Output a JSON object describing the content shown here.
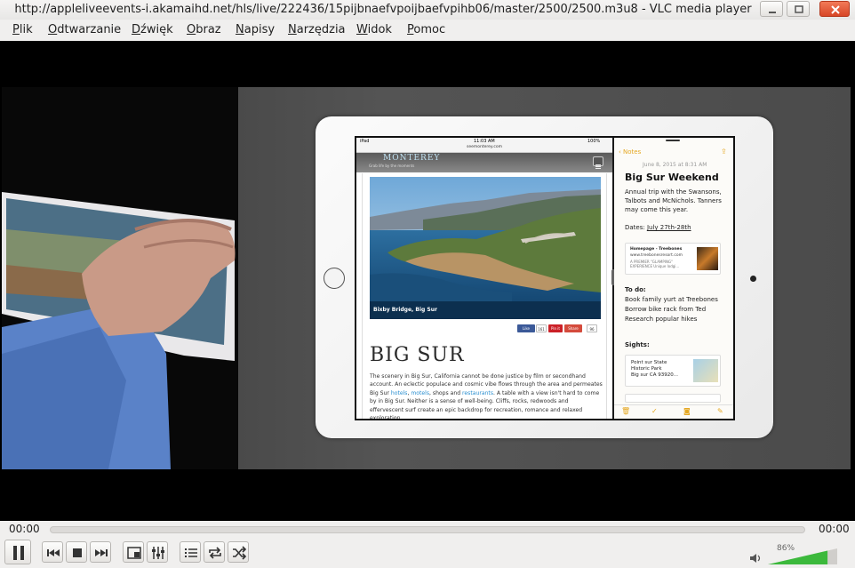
{
  "window": {
    "title": "http://appleliveevents-i.akamaihd.net/hls/live/222436/15pijbnaefvpoijbaefvpihb06/master/2500/2500.m3u8 - VLC media player"
  },
  "menu": {
    "items": [
      {
        "label": "Plik",
        "mnemonic": "P",
        "rest": "lik"
      },
      {
        "label": "Odtwarzanie",
        "mnemonic": "O",
        "rest": "dtwarzanie"
      },
      {
        "label": "Dźwięk",
        "mnemonic": "D",
        "rest": "źwięk"
      },
      {
        "label": "Obraz",
        "mnemonic": "O",
        "rest": "braz"
      },
      {
        "label": "Napisy",
        "mnemonic": "N",
        "rest": "apisy"
      },
      {
        "label": "Narzędzia",
        "mnemonic": "N",
        "rest": "arzędzia"
      },
      {
        "label": "Widok",
        "mnemonic": "W",
        "rest": "idok"
      },
      {
        "label": "Pomoc",
        "mnemonic": "P",
        "rest": "omoc"
      }
    ]
  },
  "video_content": {
    "ipad_status": {
      "carrier": "iPad",
      "time": "11:03 AM",
      "battery": "100%"
    },
    "url": "seemonterey.com",
    "site_name": "MONTEREY",
    "site_tagline": "Grab life by the moments",
    "photo_caption": "Bixby Bridge, Big Sur",
    "share": {
      "like": "Like",
      "like_count": "161",
      "pin": "Pin it",
      "share": "Share",
      "share_count": "96"
    },
    "article_title": "BIG SUR",
    "article_text_parts": [
      "The scenery in Big Sur, California cannot be done justice by film or secondhand account. An eclectic populace and cosmic vibe flows through the area and permeates Big Sur ",
      "hotels",
      ", ",
      "motels",
      ", shops and ",
      "restaurants",
      ". A table with a view isn't hard to come by in Big Sur. Neither is a sense of well-being. Cliffs, rocks, redwoods and effervescent surf create an epic backdrop for recreation, romance and relaxed exploration."
    ],
    "notes": {
      "back_label": "Notes",
      "date": "June 8, 2015 at 8:31 AM",
      "title": "Big Sur Weekend",
      "intro": "Annual trip with the Swansons, Talbots and McNichols. Tanners may come this year.",
      "dates_label": "Dates:",
      "dates_value": "July 27th-28th",
      "card1": {
        "title": "Homepage - Treebones",
        "url": "www.treebonesresort.com",
        "desc": "A PREMIER \"GLAMPING\" EXPERIENCE Unique lodgi..."
      },
      "todo_label": "To do:",
      "todo_items": [
        "Book family yurt at Treebones",
        "Borrow bike rack from Ted",
        "Research popular hikes"
      ],
      "sights_label": "Sights:",
      "card2": {
        "lines": [
          "Point sur State",
          "Historic Park",
          "Big sur CA 93920..."
        ]
      }
    }
  },
  "controls": {
    "time_elapsed": "00:00",
    "time_total": "00:00",
    "seek_progress": 0,
    "volume_percent": 86,
    "volume_label": "86%"
  },
  "icons": [
    "minimize-icon",
    "maximize-icon",
    "close-icon",
    "pause-icon",
    "previous-icon",
    "stop-icon",
    "next-icon",
    "fullscreen-icon",
    "extended-settings-icon",
    "playlist-icon",
    "loop-icon",
    "shuffle-icon",
    "speaker-icon"
  ],
  "colors": {
    "volume_green": "#3cb93c",
    "title_bar": "#ecebea",
    "close_button": "#e35a36",
    "link_blue": "#2a8fd0"
  }
}
